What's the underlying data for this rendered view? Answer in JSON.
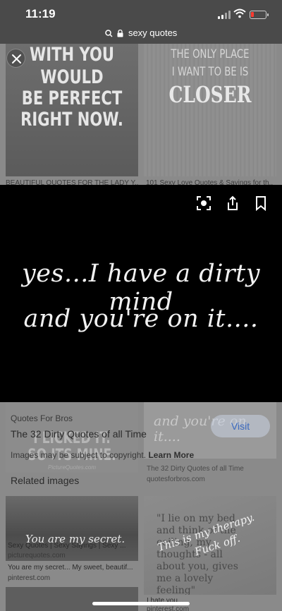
{
  "status": {
    "time": "11:19"
  },
  "urlbar": {
    "query": "sexy quotes"
  },
  "grid_top": {
    "left_quote_lines": [
      "WITH YOU",
      "WOULD",
      "BE PERFECT",
      "RIGHT NOW."
    ],
    "left_caption": "BEAUTIFUL QUOTES FOR THE LADY Y...",
    "right_quote_top": [
      "THE ONLY PLACE",
      "I WANT TO BE IS"
    ],
    "right_quote_big": "CLOSER",
    "right_caption": "101 Sexy Love Quotes & Sayings for th..."
  },
  "viewer": {
    "line1": "yes...I have a dirty mind",
    "line2": "and you're on it...."
  },
  "detail": {
    "source": "Quotes For Bros",
    "title": "The 32 Dirty Quotes of all Time",
    "visit_label": "Visit",
    "copyright_text": "Images may be subject to copyright.",
    "learn_more": "Learn More",
    "behind_left_text": [
      "I LICKED IT.",
      "SO ITS MINE."
    ],
    "behind_left_credit": "PictureQuotes.com",
    "behind_right_text": "and you're on it....",
    "behind_right_caption": "The 32 Dirty Quotes of all Time",
    "behind_right_domain": "quotesforbros.com"
  },
  "related": {
    "heading": "Related images",
    "left": {
      "overlay": "You are my secret.",
      "source_line": "Sexy Quotes | Sexy Sayings | Sexy ...",
      "domain1": "picturequotes.com",
      "caption": "You are my secret... My sweet, beautif...",
      "domain2": "pinterest.com"
    },
    "right": {
      "quote_lines": [
        "\"I lie on my bed",
        "and think of the",
        "ceiling, my",
        "thoughts - all",
        "about you, gives",
        "me a lovely",
        "feeling\""
      ],
      "overlay_lines": [
        "This is my therapy.",
        "Fuck off."
      ],
      "caption": "I hate you...",
      "domain": "pinterest.com"
    }
  },
  "colors": {
    "accent": "#3b6ac0",
    "battery_low": "#ff3b30"
  }
}
